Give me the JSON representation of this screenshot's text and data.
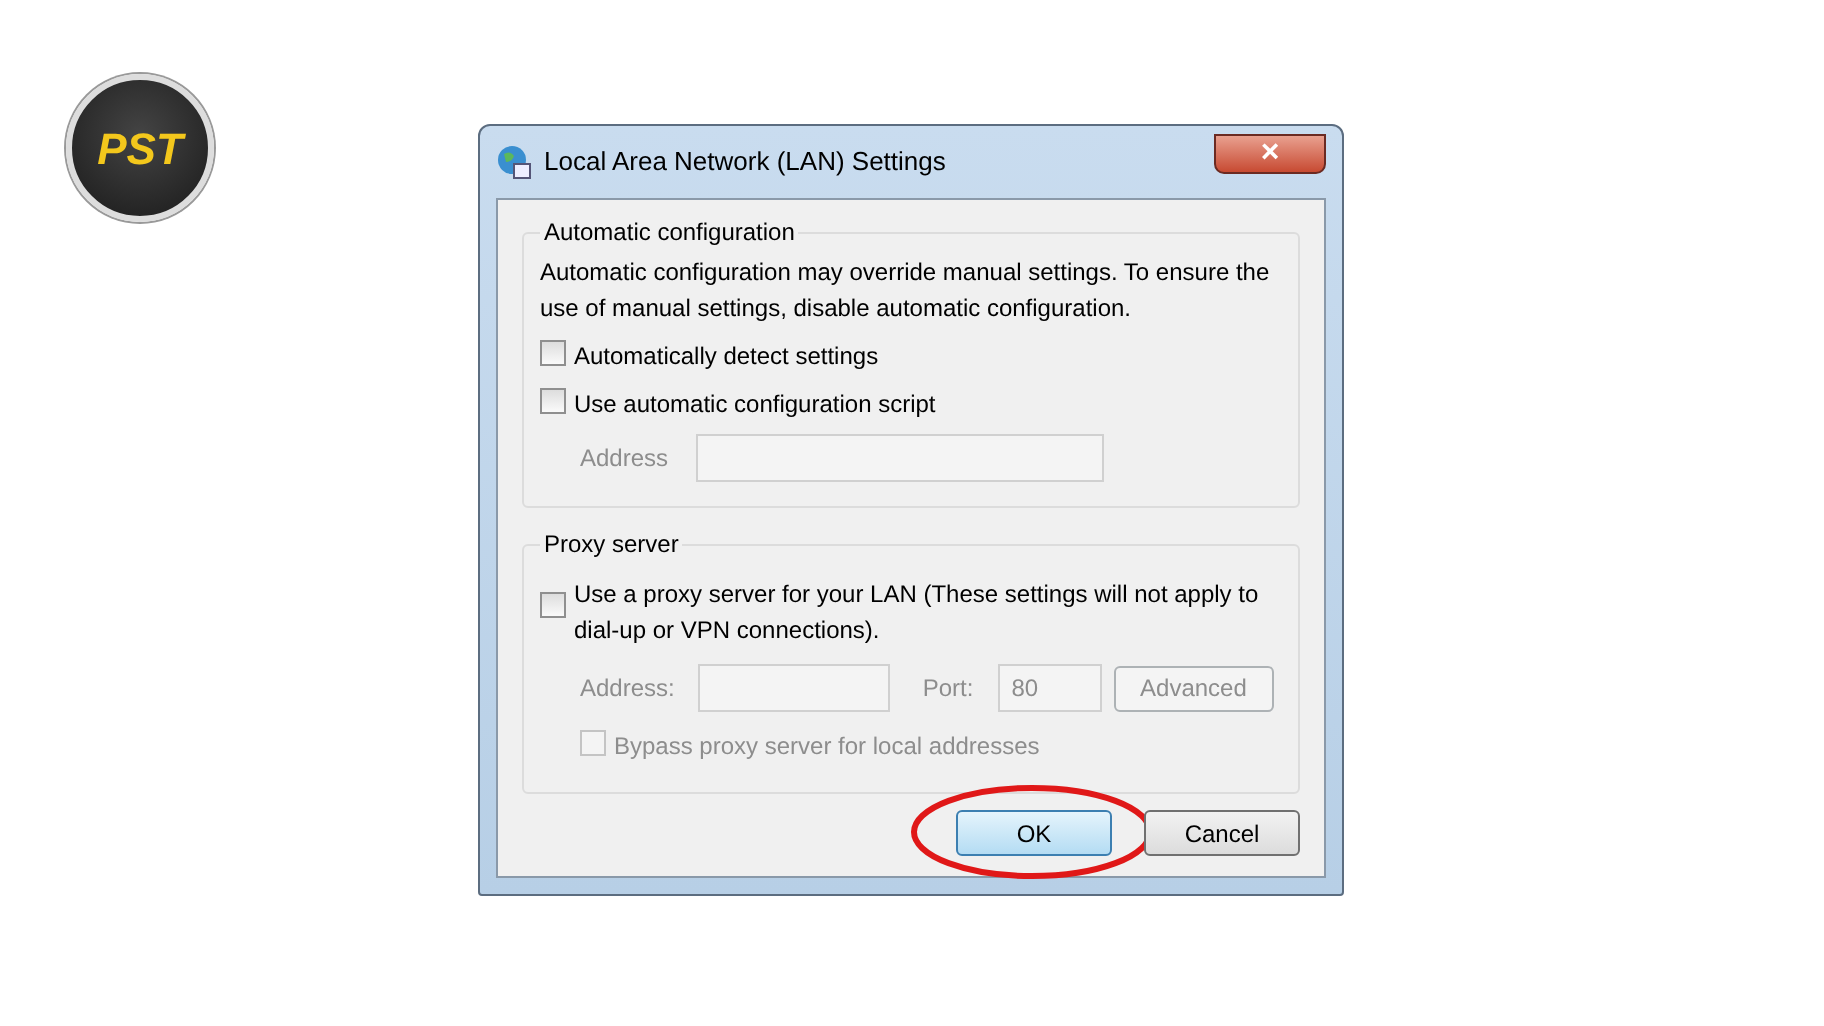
{
  "logo": {
    "text": "PST"
  },
  "window": {
    "title": "Local Area Network (LAN) Settings",
    "close": "×"
  },
  "automatic_configuration": {
    "legend": "Automatic configuration",
    "description": "Automatic configuration may override manual settings.  To ensure the use of manual settings, disable automatic configuration.",
    "options": [
      {
        "label": "Automatically detect settings",
        "checked": false,
        "disabled": false
      },
      {
        "label": "Use automatic configuration script",
        "checked": false,
        "disabled": false
      }
    ],
    "address": {
      "label": "Address",
      "disabled": true
    }
  },
  "proxy_server": {
    "legend": "Proxy server",
    "use_proxy": {
      "label": "Use a proxy server for your LAN (These settings will not apply to dial-up or VPN connections).",
      "checked": false,
      "disabled": false
    },
    "address": {
      "label": "Address:",
      "disabled": true
    },
    "port": {
      "label": "Port:",
      "value": "80",
      "disabled": true
    },
    "advanced": {
      "label": "Advanced",
      "disabled": true
    },
    "bypass": {
      "label": "Bypass proxy server for local addresses",
      "checked": false,
      "disabled": true
    }
  },
  "buttons": [
    {
      "label": "OK",
      "default": true,
      "highlighted": true
    },
    {
      "label": "Cancel",
      "default": false,
      "highlighted": false
    }
  ]
}
